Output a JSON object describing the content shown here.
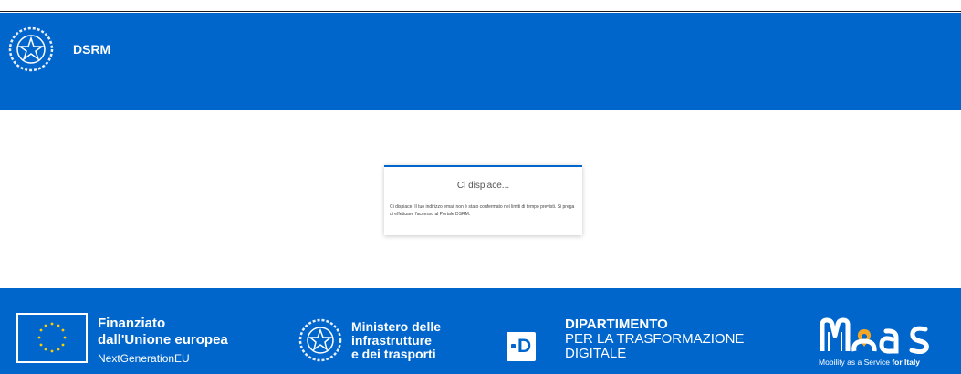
{
  "header": {
    "app_title": "DSRM",
    "emblem_icon": "italian-republic-emblem-icon"
  },
  "dialog": {
    "title": "Ci dispiace...",
    "message": "Ci dispiace. Il tuo indirizzo email non è stato confermato nei limiti di tempo previsti. Si prega di effettuare l'accesso al Portale DSRM."
  },
  "footer": {
    "eu": {
      "line1": "Finanziato",
      "line2": "dall'Unione europea",
      "line3": "NextGenerationEU",
      "icon": "eu-flag-icon"
    },
    "ministry": {
      "line1": "Ministero delle",
      "line2": "infrastrutture",
      "line3": "e dei trasporti",
      "icon": "italian-republic-emblem-icon"
    },
    "department": {
      "line1": "DIPARTIMENTO",
      "line2": "PER LA TRASFORMAZIONE",
      "line3": "DIGITALE",
      "logo_letter": "D",
      "icon": "dtd-logo-icon"
    },
    "maas": {
      "logo_text": "MaaS",
      "tagline": "Mobility as a Service",
      "tagline_bold": "for Italy",
      "icon": "maas-logo-icon"
    }
  },
  "colors": {
    "primary": "#0066cc",
    "white": "#ffffff",
    "maas_pin": "#f5a623"
  }
}
